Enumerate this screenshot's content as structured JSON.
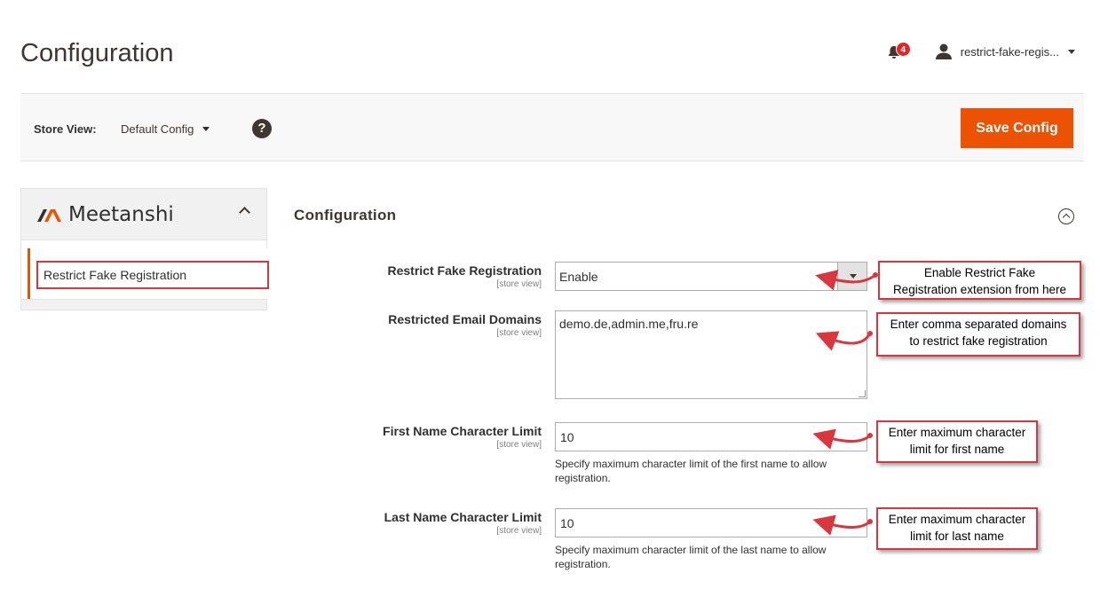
{
  "header": {
    "title": "Configuration",
    "notification_count": "4",
    "user_name": "restrict-fake-regis..."
  },
  "store_bar": {
    "label": "Store View:",
    "selected_scope": "Default Config",
    "help_icon": "?",
    "save_label": "Save Config"
  },
  "sidebar": {
    "brand": "Meetanshi",
    "items": [
      {
        "label": "Restrict Fake Registration"
      }
    ]
  },
  "main": {
    "section_title": "Configuration",
    "fields": [
      {
        "label": "Restrict Fake Registration",
        "scope": "[store view]",
        "value": "Enable"
      },
      {
        "label": "Restricted Email Domains",
        "scope": "[store view]",
        "value": "demo.de,admin.me,fru.re"
      },
      {
        "label": "First Name Character Limit",
        "scope": "[store view]",
        "value": "10",
        "note": "Specify maximum character limit of the first name to allow registration."
      },
      {
        "label": "Last Name Character Limit",
        "scope": "[store view]",
        "value": "10",
        "note": "Specify maximum character limit of the last name to allow registration."
      }
    ]
  },
  "callouts": [
    {
      "line1": "Enable Restrict Fake",
      "line2": "Registration extension from here"
    },
    {
      "line1": "Enter comma separated domains",
      "line2": "to restrict fake registration"
    },
    {
      "line1": "Enter maximum character",
      "line2": "limit for first name"
    },
    {
      "line1": "Enter maximum character",
      "line2": "limit for last name"
    }
  ],
  "colors": {
    "accent": "#eb5202",
    "annotation": "#d9363e",
    "badge": "#e22626"
  }
}
